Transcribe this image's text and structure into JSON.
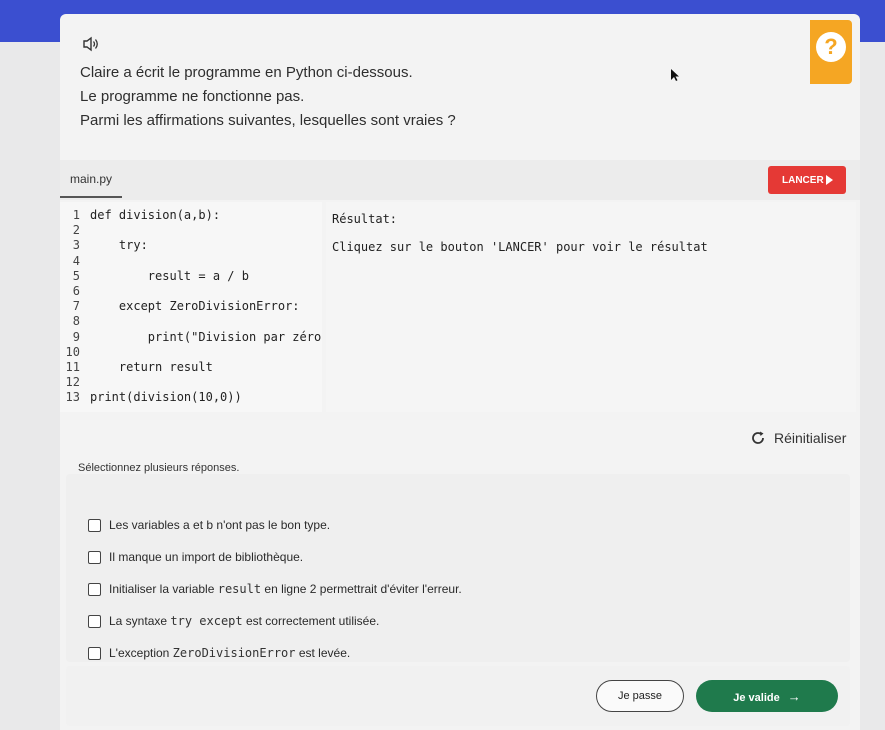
{
  "question": {
    "lines": [
      "Claire a écrit le programme en Python ci-dessous.",
      "Le programme ne fonctionne pas.",
      "Parmi les affirmations suivantes, lesquelles sont vraies ?"
    ],
    "help_mark": "?"
  },
  "editor": {
    "file_name": "main.py",
    "run_label": "LANCER",
    "code": [
      {
        "n": "1",
        "text": "def division(a,b):"
      },
      {
        "n": "2",
        "text": ""
      },
      {
        "n": "3",
        "text": "    try:"
      },
      {
        "n": "4",
        "text": ""
      },
      {
        "n": "5",
        "text": "        result = a / b"
      },
      {
        "n": "6",
        "text": ""
      },
      {
        "n": "7",
        "text": "    except ZeroDivisionError:"
      },
      {
        "n": "8",
        "text": ""
      },
      {
        "n": "9",
        "text": "        print(\"Division par zéro"
      },
      {
        "n": "10",
        "text": ""
      },
      {
        "n": "11",
        "text": "    return result"
      },
      {
        "n": "12",
        "text": ""
      },
      {
        "n": "13",
        "text": "print(division(10,0))"
      }
    ]
  },
  "output": {
    "title": "Résultat:",
    "message": "Cliquez sur le bouton 'LANCER' pour voir le résultat"
  },
  "reset_label": "Réinitialiser",
  "instruction": "Sélectionnez plusieurs réponses.",
  "options": [
    {
      "pre": "Les variables a et b n'ont pas le bon type.",
      "code": "",
      "post": ""
    },
    {
      "pre": "Il manque un import de bibliothèque.",
      "code": "",
      "post": ""
    },
    {
      "pre": "Initialiser la variable ",
      "code": "result",
      "post": " en ligne 2 permettrait d'éviter l'erreur."
    },
    {
      "pre": "La syntaxe ",
      "code": "try except",
      "post": " est correctement utilisée."
    },
    {
      "pre": "L'exception ",
      "code": "ZeroDivisionError",
      "post": " est levée."
    }
  ],
  "footer": {
    "skip_label": "Je passe",
    "validate_label": "Je valide"
  },
  "colors": {
    "topbar": "#3b4fd0",
    "run": "#e53935",
    "help": "#f5a623",
    "validate": "#1f7a4c"
  }
}
